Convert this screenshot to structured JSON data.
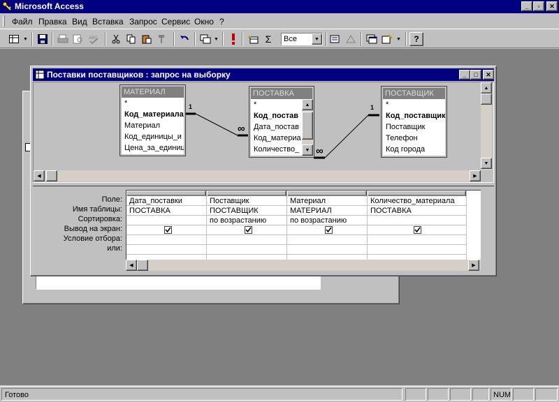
{
  "app": {
    "title": "Microsoft Access"
  },
  "menu": [
    "Файл",
    "Правка",
    "Вид",
    "Вставка",
    "Запрос",
    "Сервис",
    "Окно",
    "?"
  ],
  "toolbar": {
    "top_values": "Все"
  },
  "query_window": {
    "title": "Поставки поставщиков : запрос на выборку",
    "tables": [
      {
        "name": "МАТЕРИАЛ",
        "fields": [
          "*",
          "Код_материала",
          "Материал",
          "Код_единицы_и",
          "Цена_за_единиц"
        ],
        "key_index": 1
      },
      {
        "name": "ПОСТАВКА",
        "fields": [
          "*",
          "Код_постав",
          "Дата_постав",
          "Код_материа",
          "Количество_"
        ],
        "key_index": 1
      },
      {
        "name": "ПОСТАВЩИК",
        "fields": [
          "*",
          "Код_поставщик",
          "Поставщик",
          "Телефон",
          "Код города"
        ],
        "key_index": 1
      }
    ],
    "relations": [
      {
        "one": "1",
        "many": "∞"
      },
      {
        "one": "1",
        "many": "∞"
      }
    ],
    "grid_row_labels": [
      "Поле:",
      "Имя таблицы:",
      "Сортировка:",
      "Вывод на экран:",
      "Условие отбора:",
      "или:"
    ],
    "columns": [
      {
        "field": "Дата_поставки",
        "table": "ПОСТАВКА",
        "sort": "",
        "show": true
      },
      {
        "field": "Поставщик",
        "table": "ПОСТАВЩИК",
        "sort": "по возрастанию",
        "show": true
      },
      {
        "field": "Материал",
        "table": "МАТЕРИАЛ",
        "sort": "по возрастанию",
        "show": true
      },
      {
        "field": "Количество_материала",
        "table": "ПОСТАВКА",
        "sort": "",
        "show": true
      }
    ]
  },
  "status": {
    "text": "Готово",
    "num": "NUM"
  }
}
